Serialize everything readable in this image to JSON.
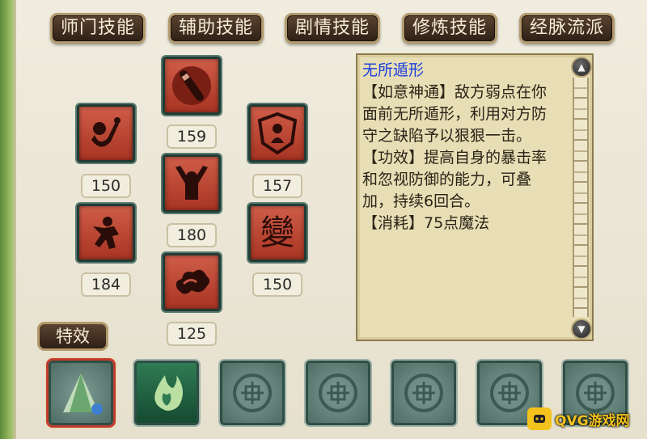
{
  "tabs": [
    {
      "label": "师门技能"
    },
    {
      "label": "辅助技能"
    },
    {
      "label": "剧情技能"
    },
    {
      "label": "修炼技能"
    },
    {
      "label": "经脉流派"
    }
  ],
  "skills": [
    {
      "icon": "staff-icon",
      "level": "159"
    },
    {
      "icon": "monkey-whip-icon",
      "level": "150"
    },
    {
      "icon": "shield-monkey-icon",
      "level": "157"
    },
    {
      "icon": "monkey-arms-up-icon",
      "level": "180"
    },
    {
      "icon": "monkey-leaping-icon",
      "level": "184"
    },
    {
      "icon": "transform-glyph-icon",
      "level": "150",
      "glyph": "變"
    },
    {
      "icon": "cloud-icon",
      "level": "125"
    }
  ],
  "description": {
    "title": "无所遁形",
    "body": "【如意神通】敌方弱点在你面前无所遁形，利用对方防守之缺陷予以狠狠一击。",
    "effect": "【功效】提高自身的暴击率和忽视防御的能力，可叠加，持续6回合。",
    "cost": "【消耗】75点魔法"
  },
  "special_effects_button": "特效",
  "effect_slots": [
    {
      "icon": "green-cone-icon",
      "state": "selected"
    },
    {
      "icon": "green-flame-icon",
      "state": "active"
    },
    {
      "icon": "empty-slot-icon",
      "state": "empty"
    },
    {
      "icon": "empty-slot-icon",
      "state": "empty"
    },
    {
      "icon": "empty-slot-icon",
      "state": "empty"
    },
    {
      "icon": "empty-slot-icon",
      "state": "empty"
    },
    {
      "icon": "empty-slot-icon",
      "state": "empty"
    }
  ],
  "watermark": "QVG游戏网",
  "colors": {
    "title_blue": "#1d3fe0",
    "skill_red": "#b8412e",
    "tab_brown": "#3e2c1e"
  }
}
